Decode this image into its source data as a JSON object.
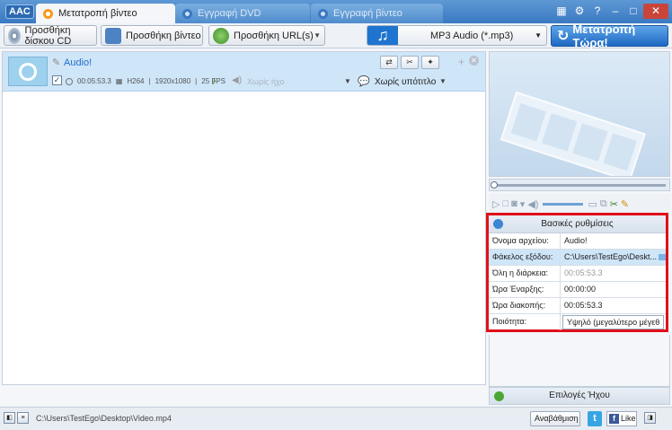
{
  "app": {
    "logo": "AAC",
    "tabs": [
      {
        "label": "Μετατροπή βίντεο"
      },
      {
        "label": "Εγγραφή DVD"
      },
      {
        "label": "Εγγραφή βίντεο"
      }
    ]
  },
  "toolbar": {
    "add_cd": "Προσθήκη δίσκου CD",
    "add_video": "Προσθήκη βίντεο",
    "add_url": "Προσθήκη URL(s)",
    "format": "MP3 Audio (*.mp3)",
    "convert": "Μετατροπή Τώρα!"
  },
  "file": {
    "name": "Audio!",
    "duration": "00:05:53.3",
    "codec": "H264",
    "resolution": "1920x1080",
    "fps": "25 FPS",
    "audio_track": "Χωρίς ήχο",
    "subtitle": "Χωρίς υπότιτλο"
  },
  "settings": {
    "header": "Βασικές ρυθμίσεις",
    "rows": [
      {
        "key": "Όνομα αρχείου:",
        "value": "Audio!"
      },
      {
        "key": "Φάκελος εξόδου:",
        "value": "C:\\Users\\TestEgo\\Deskt..."
      },
      {
        "key": "Όλη η διάρκεια:",
        "value": "00:05:53.3"
      },
      {
        "key": "Ώρα Έναρξης:",
        "value": "00:00:00"
      },
      {
        "key": "Ώρα διακοπής:",
        "value": "00:05:53.3"
      },
      {
        "key": "Ποιότητα:",
        "value": "Υψηλό (μεγαλύτερο μέγεθ"
      }
    ]
  },
  "audio_options": "Επιλογές Ήχου",
  "status": {
    "path": "C:\\Users\\TestEgo\\Desktop\\Video.mp4",
    "upgrade": "Αναβάθμιση",
    "twitter": "t",
    "like": "Like"
  },
  "colors": {
    "accent": "#1f74cf",
    "highlight_border": "#e0101a",
    "selected_row": "#cfe5f8"
  }
}
